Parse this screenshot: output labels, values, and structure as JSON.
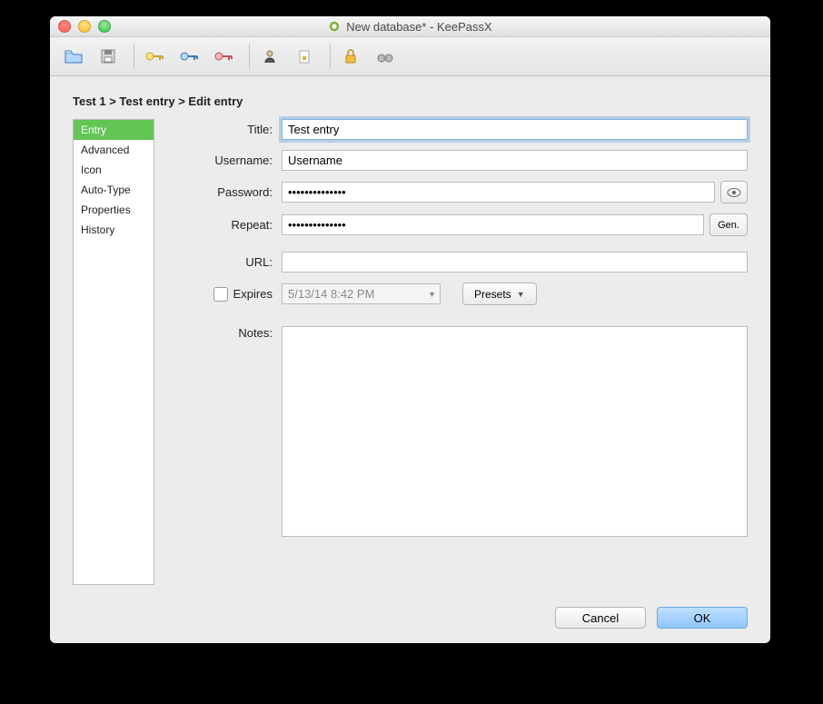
{
  "window": {
    "title": "New database* - KeePassX"
  },
  "breadcrumb": "Test 1 > Test entry > Edit entry",
  "sidebar": {
    "items": [
      {
        "label": "Entry",
        "selected": true
      },
      {
        "label": "Advanced",
        "selected": false
      },
      {
        "label": "Icon",
        "selected": false
      },
      {
        "label": "Auto-Type",
        "selected": false
      },
      {
        "label": "Properties",
        "selected": false
      },
      {
        "label": "History",
        "selected": false
      }
    ]
  },
  "form": {
    "title_label": "Title:",
    "title_value": "Test entry",
    "username_label": "Username:",
    "username_value": "Username",
    "password_label": "Password:",
    "password_value": "••••••••••••••",
    "repeat_label": "Repeat:",
    "repeat_value": "••••••••••••••",
    "gen_label": "Gen.",
    "url_label": "URL:",
    "url_value": "",
    "expires_label": "Expires",
    "expires_checked": false,
    "expires_date": "5/13/14 8:42 PM",
    "presets_label": "Presets",
    "notes_label": "Notes:",
    "notes_value": ""
  },
  "footer": {
    "cancel": "Cancel",
    "ok": "OK"
  }
}
